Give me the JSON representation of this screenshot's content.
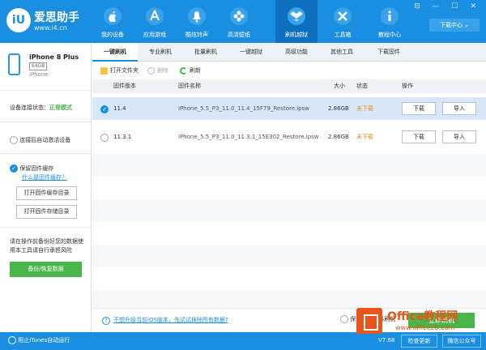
{
  "app": {
    "name": "爱思助手",
    "url": "www.i4.cn"
  },
  "nav": [
    {
      "label": "我的设备",
      "icon": "apple-icon",
      "active": false
    },
    {
      "label": "应用游戏",
      "icon": "app-store-icon",
      "active": false
    },
    {
      "label": "酷炫铃声",
      "icon": "bell-icon",
      "active": false
    },
    {
      "label": "高清壁纸",
      "icon": "flower-icon",
      "active": false
    },
    {
      "label": "刷机越狱",
      "icon": "dropbox-icon",
      "active": true
    },
    {
      "label": "工具箱",
      "icon": "tools-icon",
      "active": false
    },
    {
      "label": "教程中心",
      "icon": "info-icon",
      "active": false
    }
  ],
  "window_controls": "⊟ — ☐ ✕",
  "download_center": "下载中心 ⌄",
  "device": {
    "name": "iPhone 8 Plus",
    "capacity": "64GB",
    "type": "iPhone"
  },
  "sidebar": {
    "conn_label": "设备连接状态：",
    "conn_value": "正常模式",
    "auto_activate": "连接后自动激活设备",
    "keep_cache": "保留固件缓存",
    "what_cache": "什么是固件缓存？",
    "open_cache_dir": "打开固件缓存目录",
    "open_store_dir": "打开固件存储目录",
    "backup_hint": "请在操作前备份好您的数据使用本工具请自行承担风险",
    "backup_button": "备份/恢复数据"
  },
  "tabs": [
    "一键刷机",
    "专业刷机",
    "批量刷机",
    "一键越狱",
    "高级功能",
    "其他工具",
    "下载固件"
  ],
  "toolbar": {
    "open_folder": "打开文件夹",
    "delete": "删除",
    "refresh": "刷新"
  },
  "table": {
    "headers": {
      "version": "固件版本",
      "name": "固件名称",
      "size": "大小",
      "status": "状态",
      "action": "操作"
    },
    "rows": [
      {
        "selected": true,
        "version": "11.4",
        "name": "iPhone_5.5_P3_11.0_11.4_15F79_Restore.ipsw",
        "size": "2.86GB",
        "status": "未下载",
        "download": "下载",
        "import": "导入"
      },
      {
        "selected": false,
        "version": "11.3.1",
        "name": "iPhone_5.5_P3_11.0_11.3.1_15E302_Restore.ipsw",
        "size": "2.86GB",
        "status": "未下载",
        "download": "下载",
        "import": "导入"
      }
    ]
  },
  "bottom": {
    "question": "?",
    "question_link": "不想升级当前iOS版本，先试试抹除所有数据?",
    "keep_data": "保留用户资料刷机",
    "flash_button": "立即刷机"
  },
  "watermark": {
    "text": "Office教程网",
    "url": "www.office26.com"
  },
  "footer": {
    "stop_itunes": "阻止iTunes自动运行",
    "version": "V7.68",
    "check_update": "检查更新",
    "wechat": "微信公众号"
  },
  "colors": {
    "primary": "#1a8ee0",
    "green": "#48b548",
    "status_orange": "#f08b12",
    "watermark": "#e8541a"
  }
}
